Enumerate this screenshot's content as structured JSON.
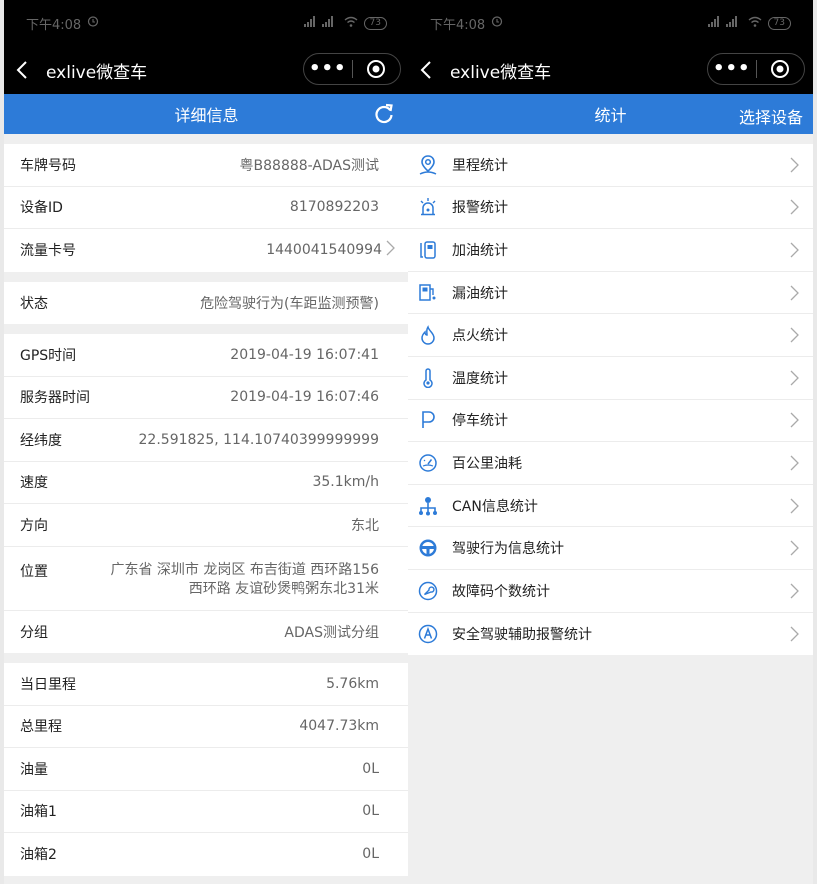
{
  "status": {
    "time": "下午4:08",
    "signal": "4G",
    "battery": "73"
  },
  "wx": {
    "title": "exlive微查车",
    "capsule_dots": "•••"
  },
  "left": {
    "header_title": "详细信息",
    "section1": [
      {
        "label": "车牌号码",
        "value": "粤B88888-ADAS测试"
      },
      {
        "label": "设备ID",
        "value": "8170892203"
      },
      {
        "label": "流量卡号",
        "value": "1440041540994"
      }
    ],
    "section2": [
      {
        "label": "状态",
        "value": "危险驾驶行为(车距监测预警)"
      }
    ],
    "section3": [
      {
        "label": "GPS时间",
        "value": "2019-04-19 16:07:41"
      },
      {
        "label": "服务器时间",
        "value": "2019-04-19 16:07:46"
      },
      {
        "label": "经纬度",
        "value": "22.591825, 114.10740399999999"
      },
      {
        "label": "速度",
        "value": "35.1km/h"
      },
      {
        "label": "方向",
        "value": "东北"
      },
      {
        "label": "位置",
        "value_line1": "广东省 深圳市 龙岗区 布吉街道 西环路156",
        "value_line2": "西环路 友谊砂煲鸭粥东北31米"
      },
      {
        "label": "分组",
        "value": "ADAS测试分组"
      }
    ],
    "section4": [
      {
        "label": "当日里程",
        "value": "5.76km"
      },
      {
        "label": "总里程",
        "value": "4047.73km"
      },
      {
        "label": "油量",
        "value": "0L"
      },
      {
        "label": "油箱1",
        "value": "0L"
      },
      {
        "label": "油箱2",
        "value": "0L"
      }
    ]
  },
  "right": {
    "header_title": "统计",
    "select_device": "选择设备",
    "items": [
      {
        "label": "里程统计",
        "icon": "location-pin-icon"
      },
      {
        "label": "报警统计",
        "icon": "alarm-light-icon"
      },
      {
        "label": "加油统计",
        "icon": "fuel-pump-icon"
      },
      {
        "label": "漏油统计",
        "icon": "fuel-leak-icon"
      },
      {
        "label": "点火统计",
        "icon": "flame-icon"
      },
      {
        "label": "温度统计",
        "icon": "thermometer-icon"
      },
      {
        "label": "停车统计",
        "icon": "parking-icon"
      },
      {
        "label": "百公里油耗",
        "icon": "gauge-icon"
      },
      {
        "label": "CAN信息统计",
        "icon": "network-tree-icon"
      },
      {
        "label": "驾驶行为信息统计",
        "icon": "steering-wheel-icon"
      },
      {
        "label": "故障码个数统计",
        "icon": "wrench-circle-icon"
      },
      {
        "label": "安全驾驶辅助报警统计",
        "icon": "letter-a-circle-icon"
      }
    ]
  },
  "colors": {
    "accent": "#2d7bd8",
    "icon": "#2d7bd8"
  }
}
